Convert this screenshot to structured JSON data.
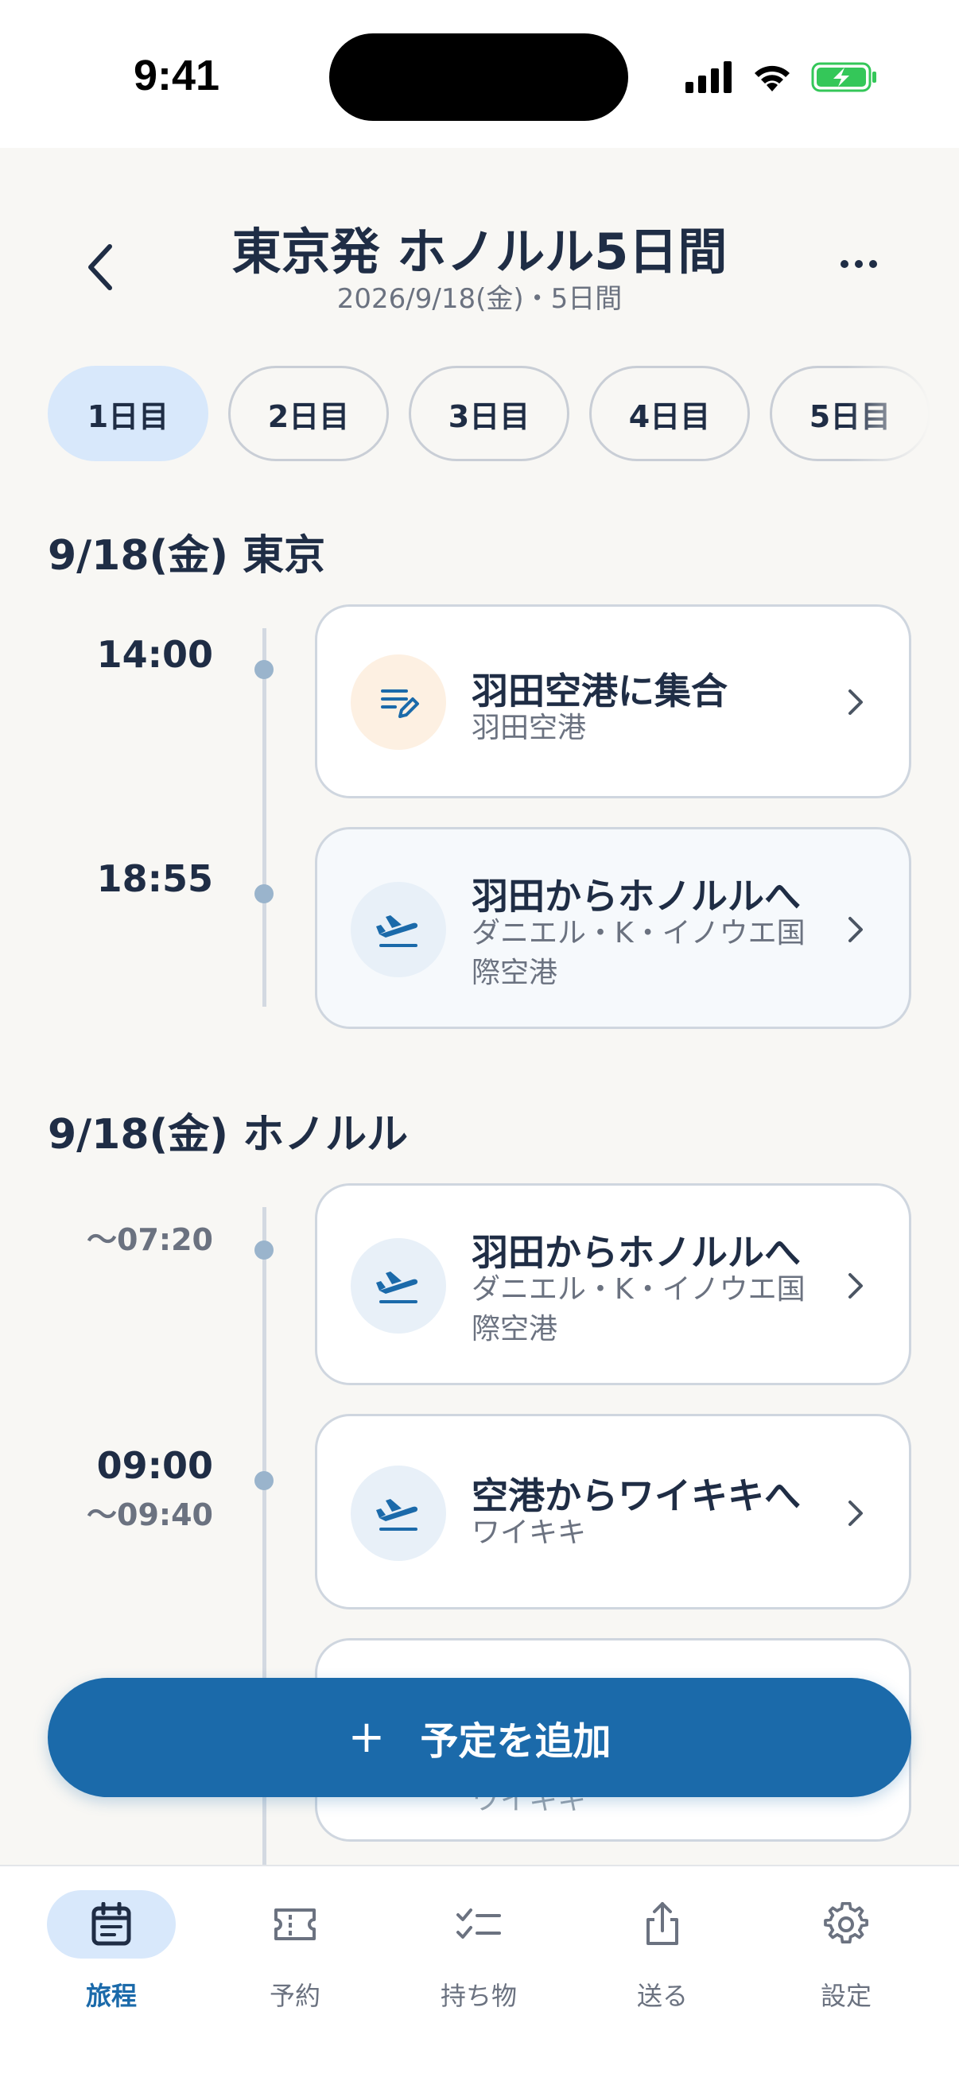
{
  "status_bar": {
    "time": "9:41"
  },
  "header": {
    "title": "東京発 ホノルル5日間",
    "subtitle": "2026/9/18(金)・5日間"
  },
  "day_tabs": [
    {
      "label": "1日目",
      "active": true
    },
    {
      "label": "2日目",
      "active": false
    },
    {
      "label": "3日目",
      "active": false
    },
    {
      "label": "4日目",
      "active": false
    },
    {
      "label": "5日目",
      "active": false
    }
  ],
  "sections": [
    {
      "heading": "9/18(金)  東京",
      "items": [
        {
          "time": "14:00",
          "title": "羽田空港に集合",
          "subtitle": "羽田空港",
          "icon": "memo-edit-icon"
        },
        {
          "time": "18:55",
          "title": "羽田からホノルルへ",
          "subtitle": "ダニエル・K・イノウエ国際空港",
          "icon": "airplane-departure-icon"
        }
      ]
    },
    {
      "heading": "9/18(金)  ホノルル",
      "items": [
        {
          "time_end": "〜07:20",
          "title": "羽田からホノルルへ",
          "subtitle": "ダニエル・K・イノウエ国際空港",
          "icon": "airplane-departure-icon"
        },
        {
          "time": "09:00",
          "time_end": "〜09:40",
          "title": "空港からワイキキへ",
          "subtitle": "ワイキキ",
          "icon": "airplane-departure-icon"
        },
        {
          "title": "",
          "subtitle": "ワイキキ"
        }
      ]
    }
  ],
  "add_button": {
    "label": "予定を追加",
    "icon": "plus-icon"
  },
  "bottom_nav": [
    {
      "label": "旅程",
      "icon": "calendar-icon",
      "active": true
    },
    {
      "label": "予約",
      "icon": "ticket-icon",
      "active": false
    },
    {
      "label": "持ち物",
      "icon": "checklist-icon",
      "active": false
    },
    {
      "label": "送る",
      "icon": "share-icon",
      "active": false
    },
    {
      "label": "設定",
      "icon": "gear-icon",
      "active": false
    }
  ],
  "colors": {
    "accent": "#1b6aaa",
    "active_tab_bg": "#d8e8fb",
    "background": "#f8f7f4",
    "text_primary": "#1f2d45",
    "text_secondary": "#6b7280",
    "timeline_dot": "#9ab4cc"
  }
}
